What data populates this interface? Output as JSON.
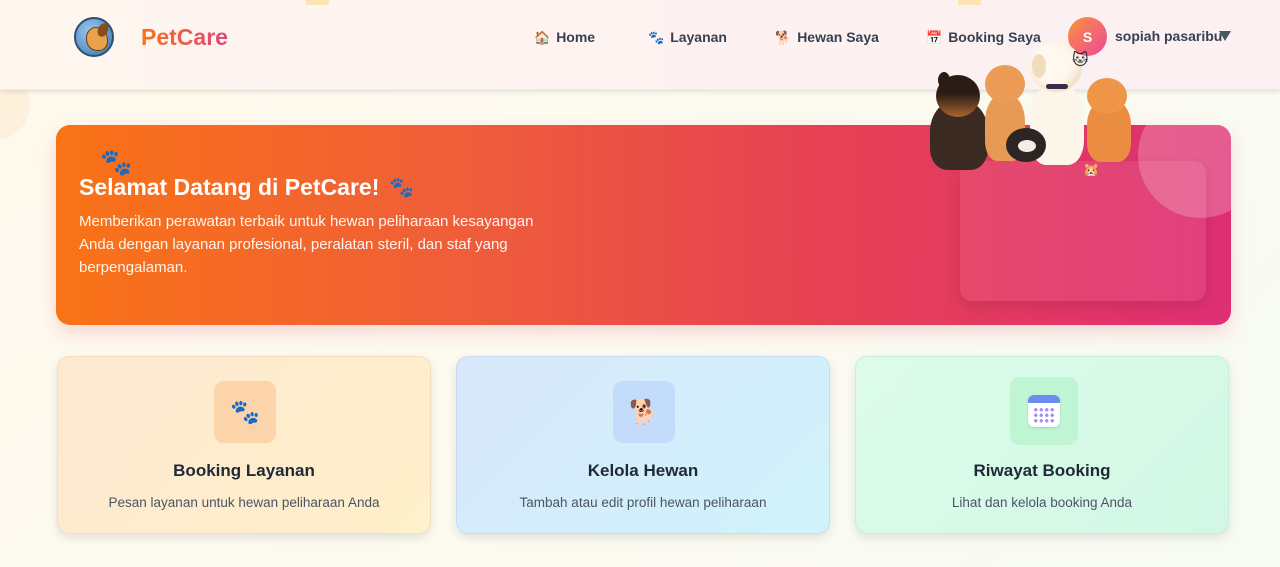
{
  "app": {
    "brand": "PetCare"
  },
  "nav": {
    "items": [
      {
        "icon": "house-icon",
        "glyph": "🏠",
        "label": "Home"
      },
      {
        "icon": "paw-icon",
        "glyph": "🐾",
        "label": "Layanan"
      },
      {
        "icon": "dog-icon",
        "glyph": "🐕",
        "label": "Hewan Saya"
      },
      {
        "icon": "calendar-icon",
        "glyph": "📅",
        "label": "Booking Saya"
      }
    ],
    "user": {
      "initial": "S",
      "name": "sopiah pasaribu"
    }
  },
  "hero": {
    "title": "Selamat Datang di PetCare!",
    "subtitle": "Memberikan perawatan terbaik untuk hewan peliharaan kesayangan Anda dengan layanan profesional, peralatan steril, dan staf yang berpengalaman."
  },
  "cards": [
    {
      "icon": "paw-icon",
      "glyph": "🐾",
      "title": "Booking Layanan",
      "description": "Pesan layanan untuk hewan peliharaan Anda"
    },
    {
      "icon": "dog-icon",
      "glyph": "🐕",
      "title": "Kelola Hewan",
      "description": "Tambah atau edit profil hewan peliharaan"
    },
    {
      "icon": "calendar-icon",
      "title": "Riwayat Booking",
      "description": "Lihat dan kelola booking Anda"
    }
  ],
  "colors": {
    "brand_gradient_start": "#f97316",
    "brand_gradient_end": "#e0457b",
    "hero_gradient_start": "#f97316",
    "hero_gradient_end": "#de2f74"
  }
}
